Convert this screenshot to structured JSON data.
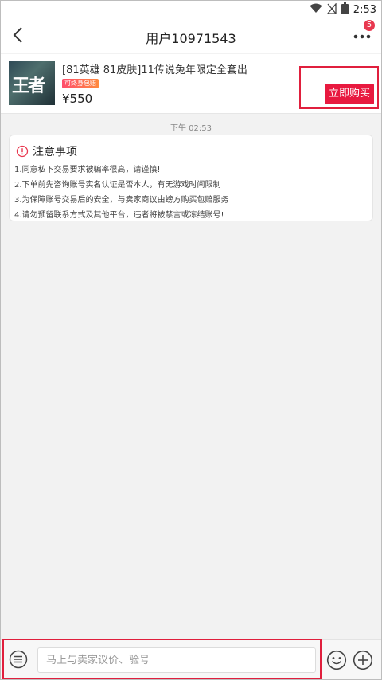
{
  "status_bar": {
    "time": "2:53",
    "icons": [
      "wifi-icon",
      "signal-off-icon",
      "battery-icon"
    ]
  },
  "header": {
    "title": "用户10971543",
    "back_icon": "chevron-left-icon",
    "more_icon": "more-dots-icon",
    "badge_count": "5"
  },
  "product": {
    "thumbnail_text": "王者",
    "title": "[81英雄 81皮肤]11传说兔年限定全套出",
    "tag": "可终身包赔",
    "price": "¥550",
    "buy_label": "立即购买"
  },
  "chat": {
    "timestamp": "下午 02:53"
  },
  "notice": {
    "icon": "alert-circle-icon",
    "title": "注意事项",
    "lines": [
      "1.同意私下交易要求被骗率很高，请谨慎!",
      "2.下单前先咨询账号实名认证是否本人，有无游戏时间限制",
      "3.为保障账号交易后的安全，与卖家商议由螃方购买包赔服务",
      "4.请勿预留联系方式及其他平台，违者将被禁言或冻结账号!"
    ]
  },
  "input_bar": {
    "menu_icon": "menu-circle-icon",
    "placeholder": "马上与卖家议价、验号",
    "emoji_icon": "emoji-icon",
    "plus_icon": "plus-circle-icon"
  },
  "colors": {
    "accent": "#e8193f",
    "highlight_border": "#e01f3d",
    "badge": "#e8384f"
  }
}
